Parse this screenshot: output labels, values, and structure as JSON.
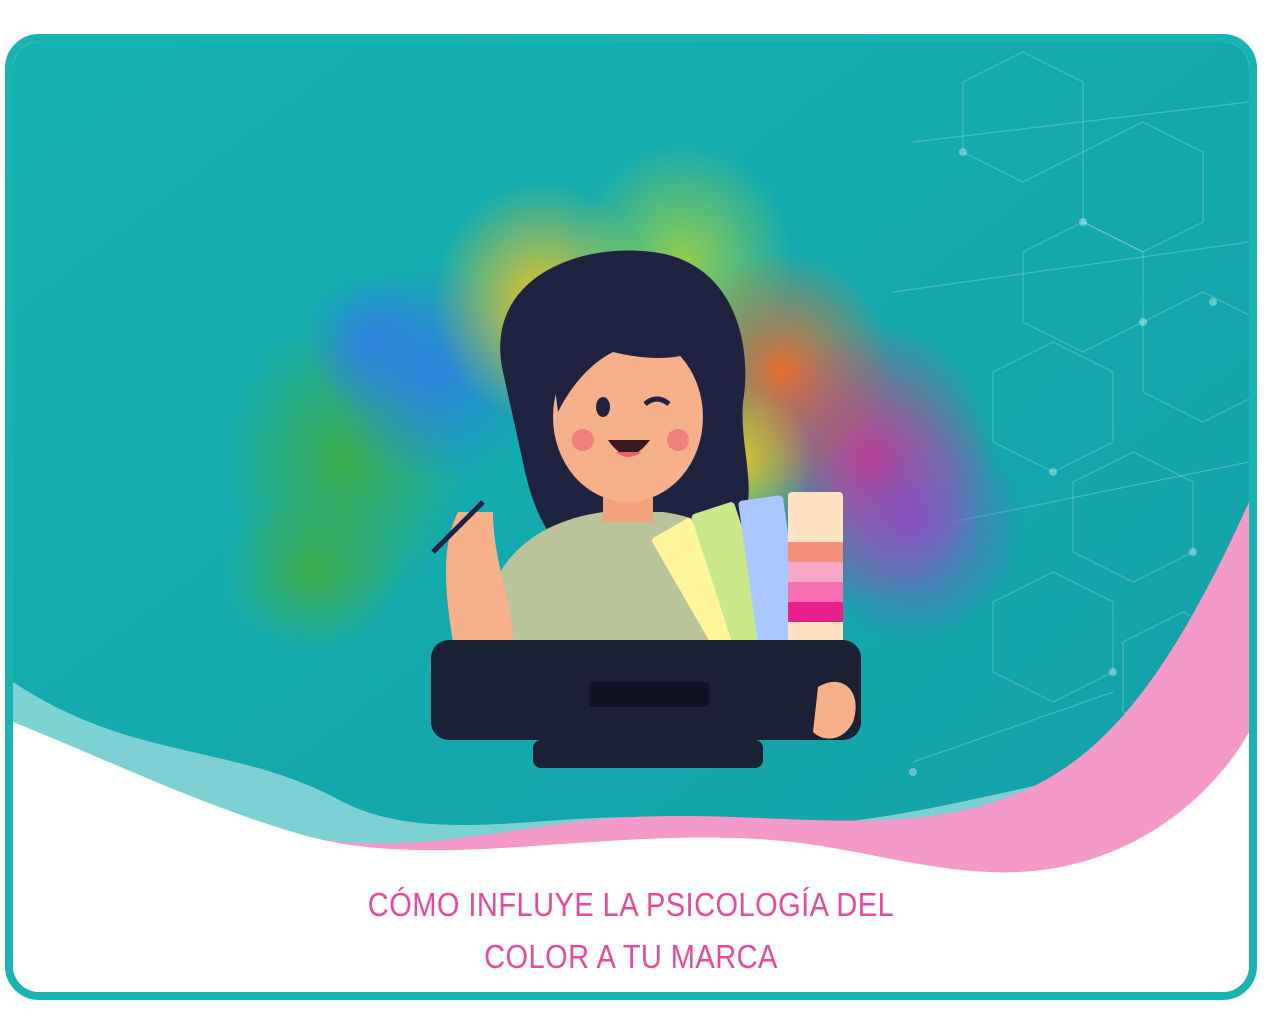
{
  "colors": {
    "frame": "#19b3b3",
    "background_teal": "#14adad",
    "accent_pink": "#e6499d",
    "wave_pink": "#f39ac8",
    "wave_light": "#8fd8d8"
  },
  "illustration": {
    "subject": "woman-designer-with-color-swatches-and-tablet"
  },
  "title": {
    "line1": "CÓMO INFLUYE LA PSICOLOGÍA DEL",
    "line2": "COLOR A TU MARCA"
  }
}
